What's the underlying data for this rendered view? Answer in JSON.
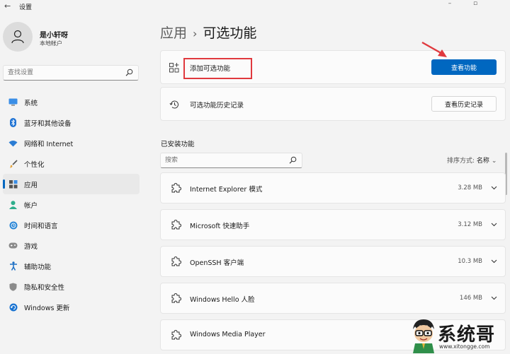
{
  "window": {
    "title": "设置"
  },
  "profile": {
    "name": "是小轩呀",
    "account_type": "本地帐户"
  },
  "sidebar": {
    "search_placeholder": "查找设置",
    "items": [
      {
        "label": "系统",
        "icon": "monitor-icon",
        "active": false
      },
      {
        "label": "蓝牙和其他设备",
        "icon": "bluetooth-icon",
        "active": false
      },
      {
        "label": "网络和 Internet",
        "icon": "wifi-icon",
        "active": false
      },
      {
        "label": "个性化",
        "icon": "brush-icon",
        "active": false
      },
      {
        "label": "应用",
        "icon": "apps-icon",
        "active": true
      },
      {
        "label": "帐户",
        "icon": "person-icon",
        "active": false
      },
      {
        "label": "时间和语言",
        "icon": "globe-clock-icon",
        "active": false
      },
      {
        "label": "游戏",
        "icon": "gamepad-icon",
        "active": false
      },
      {
        "label": "辅助功能",
        "icon": "accessibility-icon",
        "active": false
      },
      {
        "label": "隐私和安全性",
        "icon": "shield-icon",
        "active": false
      },
      {
        "label": "Windows 更新",
        "icon": "update-icon",
        "active": false
      }
    ]
  },
  "breadcrumb": {
    "parent": "应用",
    "separator": "›",
    "current": "可选功能"
  },
  "add_feature": {
    "label": "添加可选功能",
    "button": "查看功能"
  },
  "history": {
    "label": "可选功能历史记录",
    "button": "查看历史记录"
  },
  "installed": {
    "title": "已安装功能",
    "search_placeholder": "搜索",
    "sort_label": "排序方式:",
    "sort_value": "名称",
    "features": [
      {
        "name": "Internet Explorer 模式",
        "size": "3.28 MB"
      },
      {
        "name": "Microsoft 快速助手",
        "size": "3.12 MB"
      },
      {
        "name": "OpenSSH 客户端",
        "size": "10.3 MB"
      },
      {
        "name": "Windows Hello 人脸",
        "size": "146 MB"
      },
      {
        "name": "Windows Media Player",
        "size": ""
      }
    ]
  },
  "watermark": {
    "brand": "系统哥",
    "url": "www.xitongge.com"
  },
  "colors": {
    "accent": "#0067c0",
    "highlight": "#e0393e"
  }
}
